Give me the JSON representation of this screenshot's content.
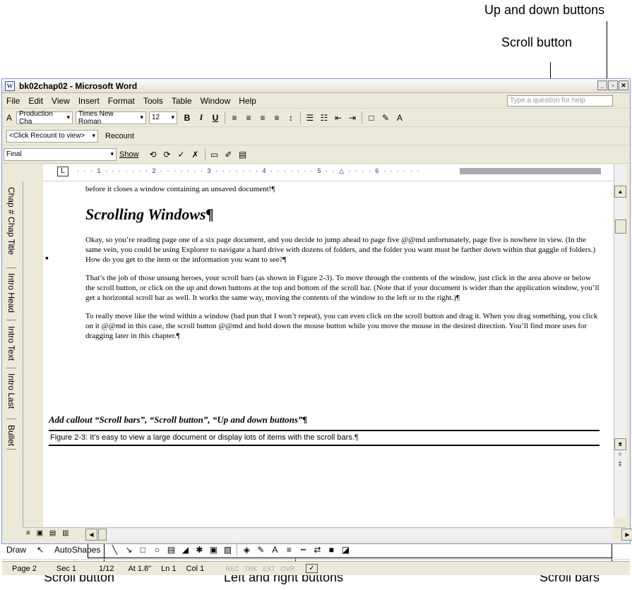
{
  "callouts": {
    "top_up_down": "Up and down buttons",
    "top_scroll_button": "Scroll button",
    "bottom_scroll_button": "Scroll button",
    "bottom_left_right": "Left and right buttons",
    "bottom_scroll_bars": "Scroll bars"
  },
  "window": {
    "icon": "W",
    "title": "bk02chap02 - Microsoft Word",
    "controls": [
      "minimize-icon",
      "restore-icon",
      "close-icon"
    ]
  },
  "menu": {
    "items": [
      "File",
      "Edit",
      "View",
      "Insert",
      "Format",
      "Tools",
      "Table",
      "Window",
      "Help"
    ],
    "help_placeholder": "Type a question for help"
  },
  "formatting": {
    "style": "Production Cha",
    "font": "Times New Roman",
    "size": "12",
    "bold": "B",
    "italic": "I",
    "underline": "U"
  },
  "reviewing": {
    "recount_combo": "<Click Recount to view>",
    "recount_button": "Recount"
  },
  "markup": {
    "display": "Final",
    "show": "Show"
  },
  "style_area": {
    "labels": [
      "Chap # Chap Title",
      "Intro Head",
      "Intro Text",
      "Intro Last",
      "Bullet"
    ]
  },
  "ruler": {
    "marks": "· · · 1 · · · · · · · 2 · · · · · · · 3 · · · · · · · 4 · · · · · · · 5 · · △ · · · · 6 · · · · · ·"
  },
  "document": {
    "p0": "before it closes a window containing an unsaved document!¶",
    "heading": "Scrolling Windows¶",
    "p1": "Okay, so you’re reading page one of a six page document, and you decide to jump ahead to page five @@md unfortunately, page five is nowhere in view. (In the same vein, you could be using Explorer to navigate a hard drive with dozens of folders, and the folder you want must be farther down within that gaggle of folders.) How do you get to the item or the information you want to see?¶",
    "p2": "That’s the job of those unsung heroes, your scroll bars (as shown in Figure 2-3). To move through the contents of the window, just click in the area above or below the scroll button, or click on the up and down buttons at the top and bottom of the scroll bar. (Note that if your document is wider than the application window, you’ll get a horizontal scroll bar as well. It works the same way, moving the contents of the window to the left or to the right.)¶",
    "p3": "To really move like the wind within a window (bad pun that I won’t repeat), you can even click on the scroll button and drag it. When you drag something, you click on it @@md in this case, the scroll button @@md and hold down the mouse button while you move the mouse in the desired direction. You’ll find more uses for dragging later in this chapter.¶",
    "callout_text": "Add callout “Scroll bars”, “Scroll button”, “Up and down buttons”¶",
    "caption": "Figure 2-3: It’s easy to view a large document or display lots of items with the scroll bars.¶"
  },
  "drawing": {
    "draw": "Draw",
    "autoshapes": "AutoShapes"
  },
  "status": {
    "page": "Page 2",
    "sec": "Sec 1",
    "pages": "1/12",
    "at": "At 1.8\"",
    "ln": "Ln 1",
    "col": "Col 1",
    "rec": "REC",
    "trk": "TRK",
    "ext": "EXT",
    "ovr": "OVR"
  }
}
